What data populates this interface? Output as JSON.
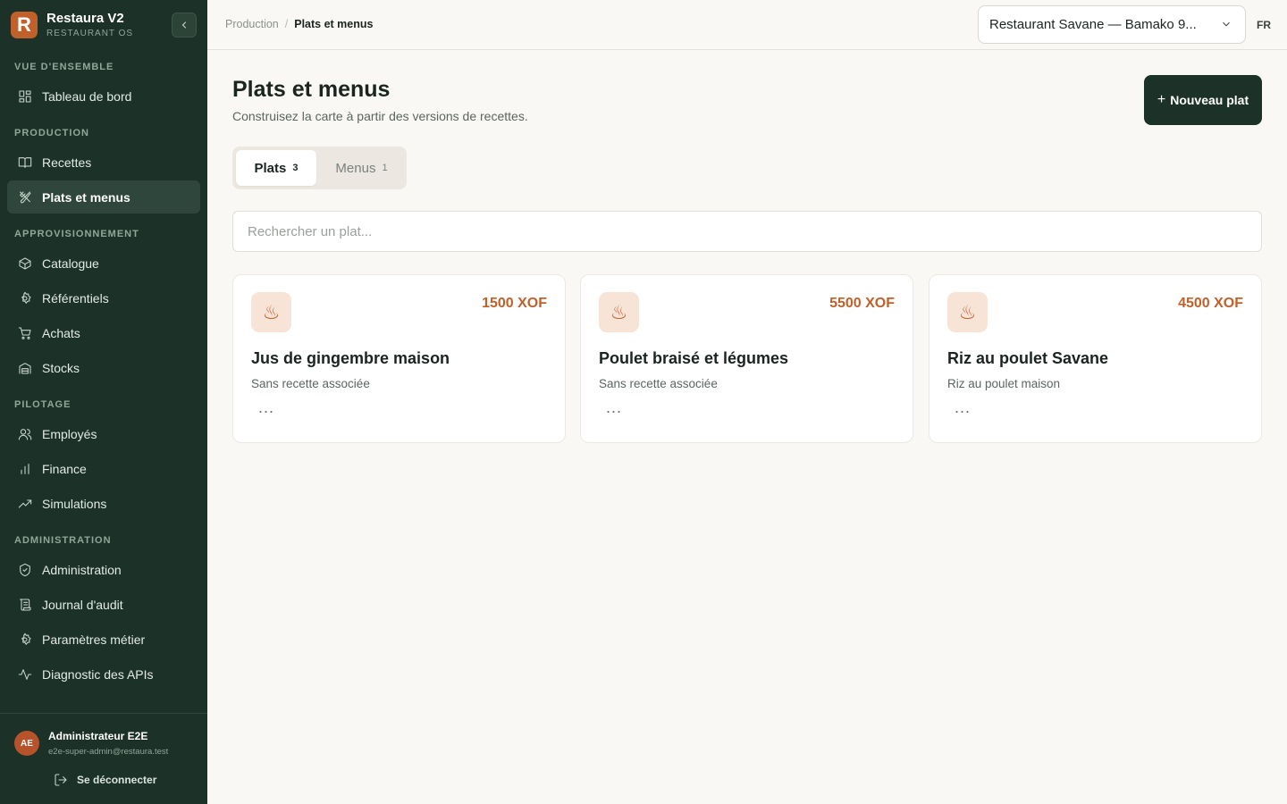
{
  "app": {
    "logo_letter": "R",
    "name": "Restaura V2",
    "subtitle": "RESTAURANT OS"
  },
  "sidebar": {
    "collapse_icon": "chevron-left-icon",
    "sections": [
      {
        "title": "VUE D'ENSEMBLE",
        "items": [
          {
            "label": "Tableau de bord",
            "icon": "dashboard-icon"
          }
        ]
      },
      {
        "title": "PRODUCTION",
        "items": [
          {
            "label": "Recettes",
            "icon": "book-icon"
          },
          {
            "label": "Plats et menus",
            "icon": "utensils-icon",
            "active": true
          }
        ]
      },
      {
        "title": "APPROVISIONNEMENT",
        "items": [
          {
            "label": "Catalogue",
            "icon": "package-icon"
          },
          {
            "label": "Référentiels",
            "icon": "settings-icon"
          },
          {
            "label": "Achats",
            "icon": "cart-icon"
          },
          {
            "label": "Stocks",
            "icon": "warehouse-icon"
          }
        ]
      },
      {
        "title": "PILOTAGE",
        "items": [
          {
            "label": "Employés",
            "icon": "users-icon"
          },
          {
            "label": "Finance",
            "icon": "bar-chart-icon"
          },
          {
            "label": "Simulations",
            "icon": "trending-up-icon"
          }
        ]
      },
      {
        "title": "ADMINISTRATION",
        "items": [
          {
            "label": "Administration",
            "icon": "shield-check-icon"
          },
          {
            "label": "Journal d'audit",
            "icon": "scroll-icon"
          },
          {
            "label": "Paramètres métier",
            "icon": "settings-icon"
          },
          {
            "label": "Diagnostic des APIs",
            "icon": "activity-icon"
          }
        ]
      }
    ],
    "user": {
      "initials": "AE",
      "name": "Administrateur E2E",
      "email": "e2e-super-admin@restaura.test"
    },
    "logout_label": "Se déconnecter"
  },
  "header": {
    "breadcrumb": {
      "parent": "Production",
      "separator": "/",
      "current": "Plats et menus"
    },
    "restaurant_select": "Restaurant Savane — Bamako 9...",
    "language": "FR"
  },
  "main": {
    "title": "Plats et menus",
    "subtitle": "Construisez la carte à partir des versions de recettes.",
    "new_button": {
      "plus": "+",
      "label": "Nouveau plat"
    },
    "tabs": [
      {
        "label": "Plats",
        "count": "3",
        "active": true
      },
      {
        "label": "Menus",
        "count": "1",
        "active": false
      }
    ],
    "search_placeholder": "Rechercher un plat...",
    "dishes": [
      {
        "name": "Jus de gingembre maison",
        "price": "1500 XOF",
        "recipe": "Sans recette associée",
        "icon": "dish-steam-icon",
        "more": "..."
      },
      {
        "name": "Poulet braisé et légumes",
        "price": "5500 XOF",
        "recipe": "Sans recette associée",
        "icon": "dish-steam-icon",
        "more": "..."
      },
      {
        "name": "Riz au poulet Savane",
        "price": "4500 XOF",
        "recipe": "Riz au poulet maison",
        "icon": "dish-steam-icon",
        "more": "..."
      }
    ]
  },
  "colors": {
    "sidebar_bg": "#1c3128",
    "accent": "#c0602a",
    "page_bg": "#f9f8f5"
  }
}
